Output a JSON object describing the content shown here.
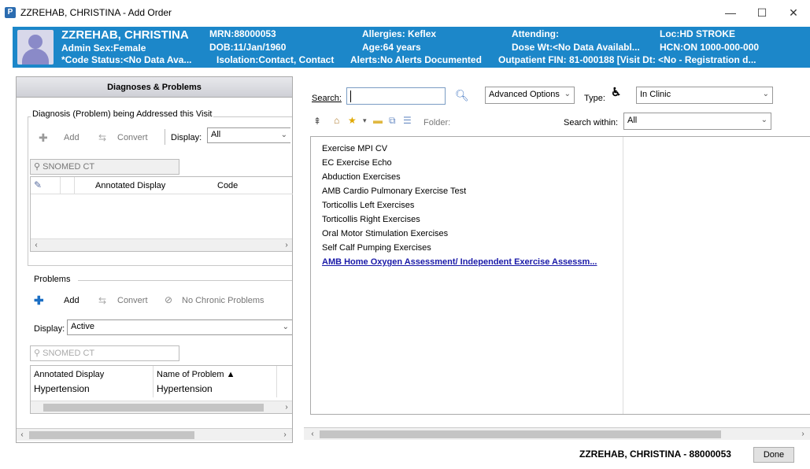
{
  "window": {
    "app_icon_letter": "P",
    "title": "ZZREHAB, CHRISTINA - Add Order",
    "minimize": "—",
    "maximize": "☐",
    "close": "✕"
  },
  "banner": {
    "name": "ZZREHAB, CHRISTINA",
    "admin_sex": "Admin Sex:Female",
    "code_status": "*Code Status:<No Data Ava...",
    "mrn": "MRN:88000053",
    "dob": "DOB:11/Jan/1960",
    "isolation": "Isolation:Contact, Contact",
    "allergies": "Allergies: Keflex",
    "age": "Age:64 years",
    "alerts": "Alerts:No Alerts Documented",
    "attending": "Attending:",
    "dose_wt": "Dose Wt:<No Data Availabl...",
    "outpatient": "Outpatient FIN: 81-000188 [Visit Dt: <No - Registration d...",
    "loc": "Loc:HD STROKE",
    "hcn": "HCN:ON 1000-000-000"
  },
  "left": {
    "header": "Diagnoses & Problems",
    "diag_group": "Diagnosis (Problem) being Addressed this Visit",
    "add": "Add",
    "convert": "Convert",
    "display_label": "Display:",
    "display_value": "All",
    "snomed": "SNOMED CT",
    "diag_columns": [
      "Annotated Display",
      "Code"
    ],
    "problems_group": "Problems",
    "no_chronic": "No Chronic Problems",
    "prob_display_value": "Active",
    "prob_columns": [
      "Annotated Display",
      "Name of Problem ▲"
    ],
    "prob_rows": [
      {
        "annotated": "Hypertension",
        "name": "Hypertension"
      }
    ]
  },
  "right": {
    "search_label": "Search:",
    "search_value": "",
    "advanced": "Advanced Options",
    "type_label": "Type:",
    "type_value": "In Clinic",
    "folder_label": "Folder:",
    "search_within_label": "Search within:",
    "search_within_value": "All",
    "results": [
      "Exercise MPI CV",
      "EC Exercise Echo",
      "Abduction Exercises",
      "AMB Cardio Pulmonary Exercise Test",
      "Torticollis Left Exercises",
      "Torticollis Right Exercises",
      "Oral Motor Stimulation Exercises",
      "Self Calf Pumping Exercises",
      "AMB Home Oxygen Assessment/ Independent Exercise Assessm..."
    ]
  },
  "footer": {
    "patient": "ZZREHAB, CHRISTINA - 88000053",
    "done": "Done"
  },
  "colors": {
    "banner": "#1c87c9",
    "link": "#1a1aa8"
  }
}
